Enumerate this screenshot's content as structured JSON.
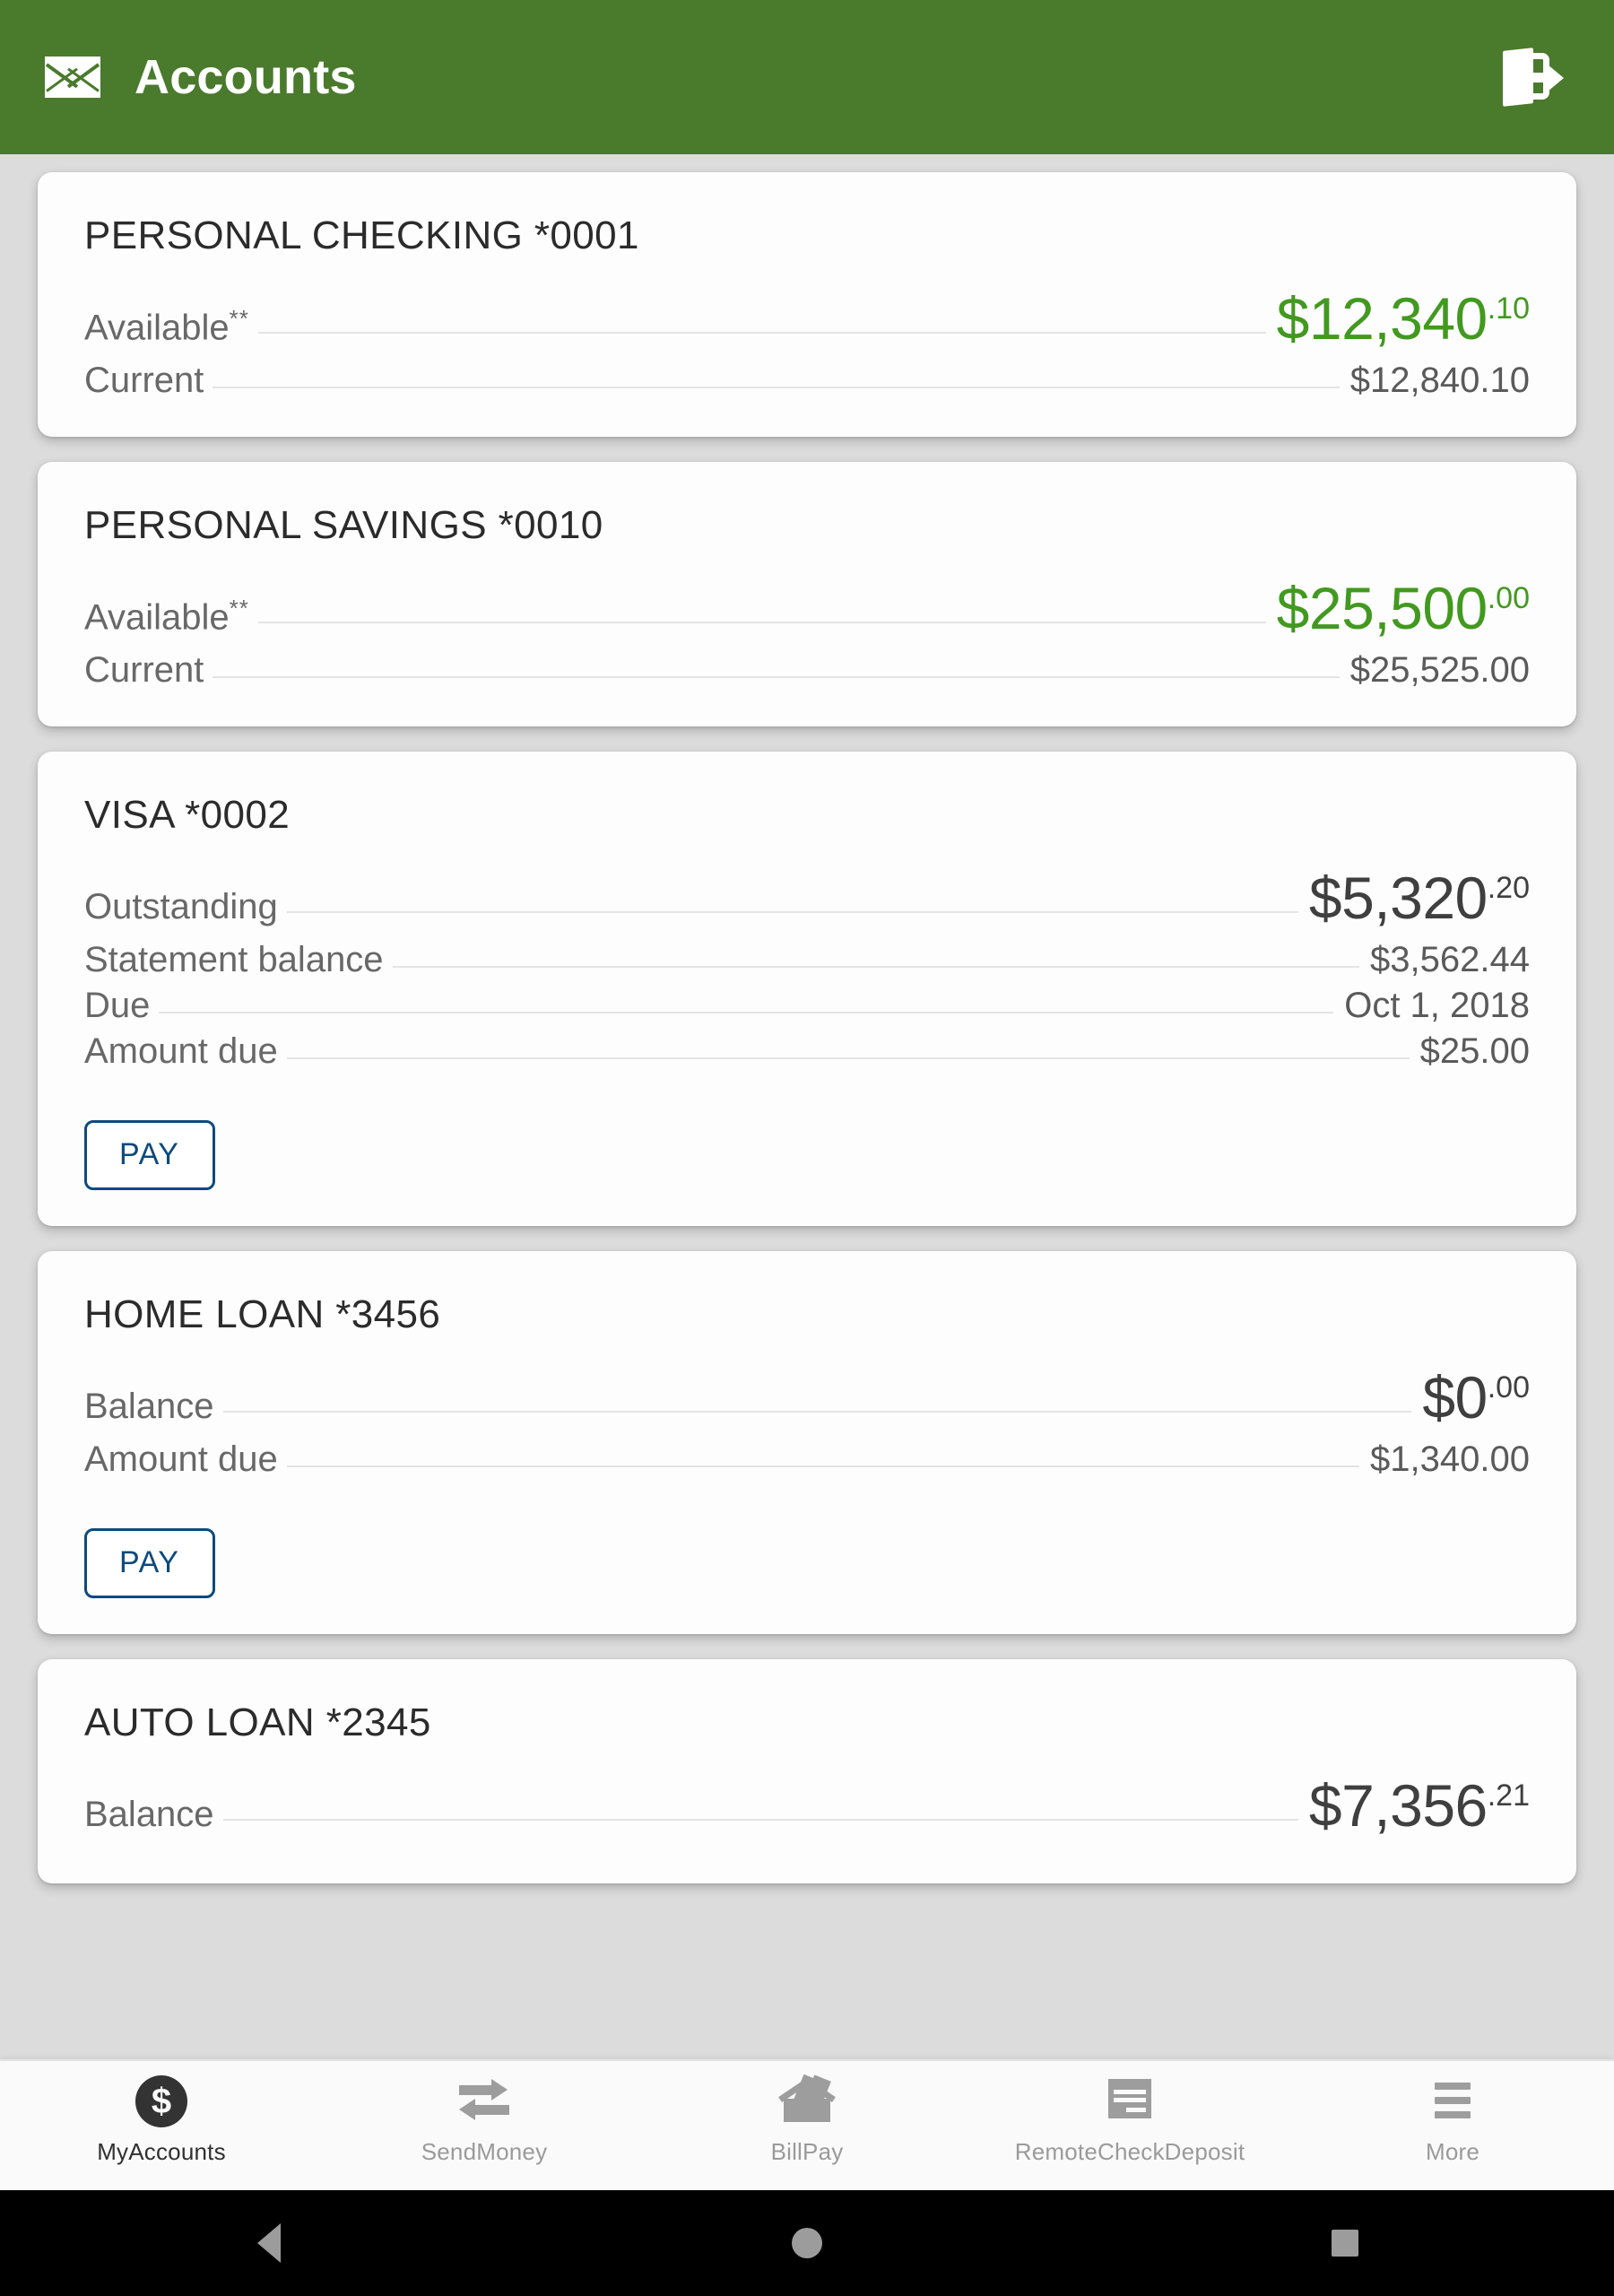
{
  "header": {
    "title": "Accounts",
    "mail_icon": "envelope-icon",
    "logout_icon": "logout-icon",
    "background_color": "#4a7a2c"
  },
  "colors": {
    "header_green": "#4a7a2c",
    "amount_green": "#42991f",
    "pay_blue": "#0d4a7d",
    "page_background": "#dcdcdc",
    "card_background": "#fdfdfd"
  },
  "accounts": [
    {
      "title": "PERSONAL CHECKING *0001",
      "hero": {
        "label": "Available",
        "footnote": "**",
        "dollars": "$12,340",
        "cents": ".10",
        "green": true
      },
      "rows": [
        {
          "label": "Current",
          "value": "$12,840.10"
        }
      ],
      "pay_label": null
    },
    {
      "title": "PERSONAL SAVINGS *0010",
      "hero": {
        "label": "Available",
        "footnote": "**",
        "dollars": "$25,500",
        "cents": ".00",
        "green": true
      },
      "rows": [
        {
          "label": "Current",
          "value": "$25,525.00"
        }
      ],
      "pay_label": null
    },
    {
      "title": "VISA *0002",
      "hero": {
        "label": "Outstanding",
        "footnote": "",
        "dollars": "$5,320",
        "cents": ".20",
        "green": false
      },
      "rows": [
        {
          "label": "Statement balance",
          "value": "$3,562.44"
        },
        {
          "label": "Due",
          "value": "Oct 1, 2018"
        },
        {
          "label": "Amount due",
          "value": "$25.00"
        }
      ],
      "pay_label": "PAY"
    },
    {
      "title": "HOME LOAN *3456",
      "hero": {
        "label": "Balance",
        "footnote": "",
        "dollars": "$0",
        "cents": ".00",
        "green": false
      },
      "rows": [
        {
          "label": "Amount due",
          "value": "$1,340.00"
        }
      ],
      "pay_label": "PAY"
    },
    {
      "title": "AUTO LOAN *2345",
      "hero": {
        "label": "Balance",
        "footnote": "",
        "dollars": "$7,356",
        "cents": ".21",
        "green": false
      },
      "rows": [],
      "pay_label": null
    }
  ],
  "tabbar": {
    "items": [
      {
        "label": "MyAccounts",
        "icon": "dollar-circle-icon",
        "active": true
      },
      {
        "label": "SendMoney",
        "icon": "transfer-arrows-icon",
        "active": false
      },
      {
        "label": "BillPay",
        "icon": "envelope-mail-icon",
        "active": false
      },
      {
        "label": "RemoteCheckDeposit",
        "icon": "check-document-icon",
        "active": false
      },
      {
        "label": "More",
        "icon": "hamburger-menu-icon",
        "active": false
      }
    ]
  },
  "system_nav": {
    "back": "back-triangle-icon",
    "home": "home-circle-icon",
    "recents": "recents-square-icon"
  }
}
